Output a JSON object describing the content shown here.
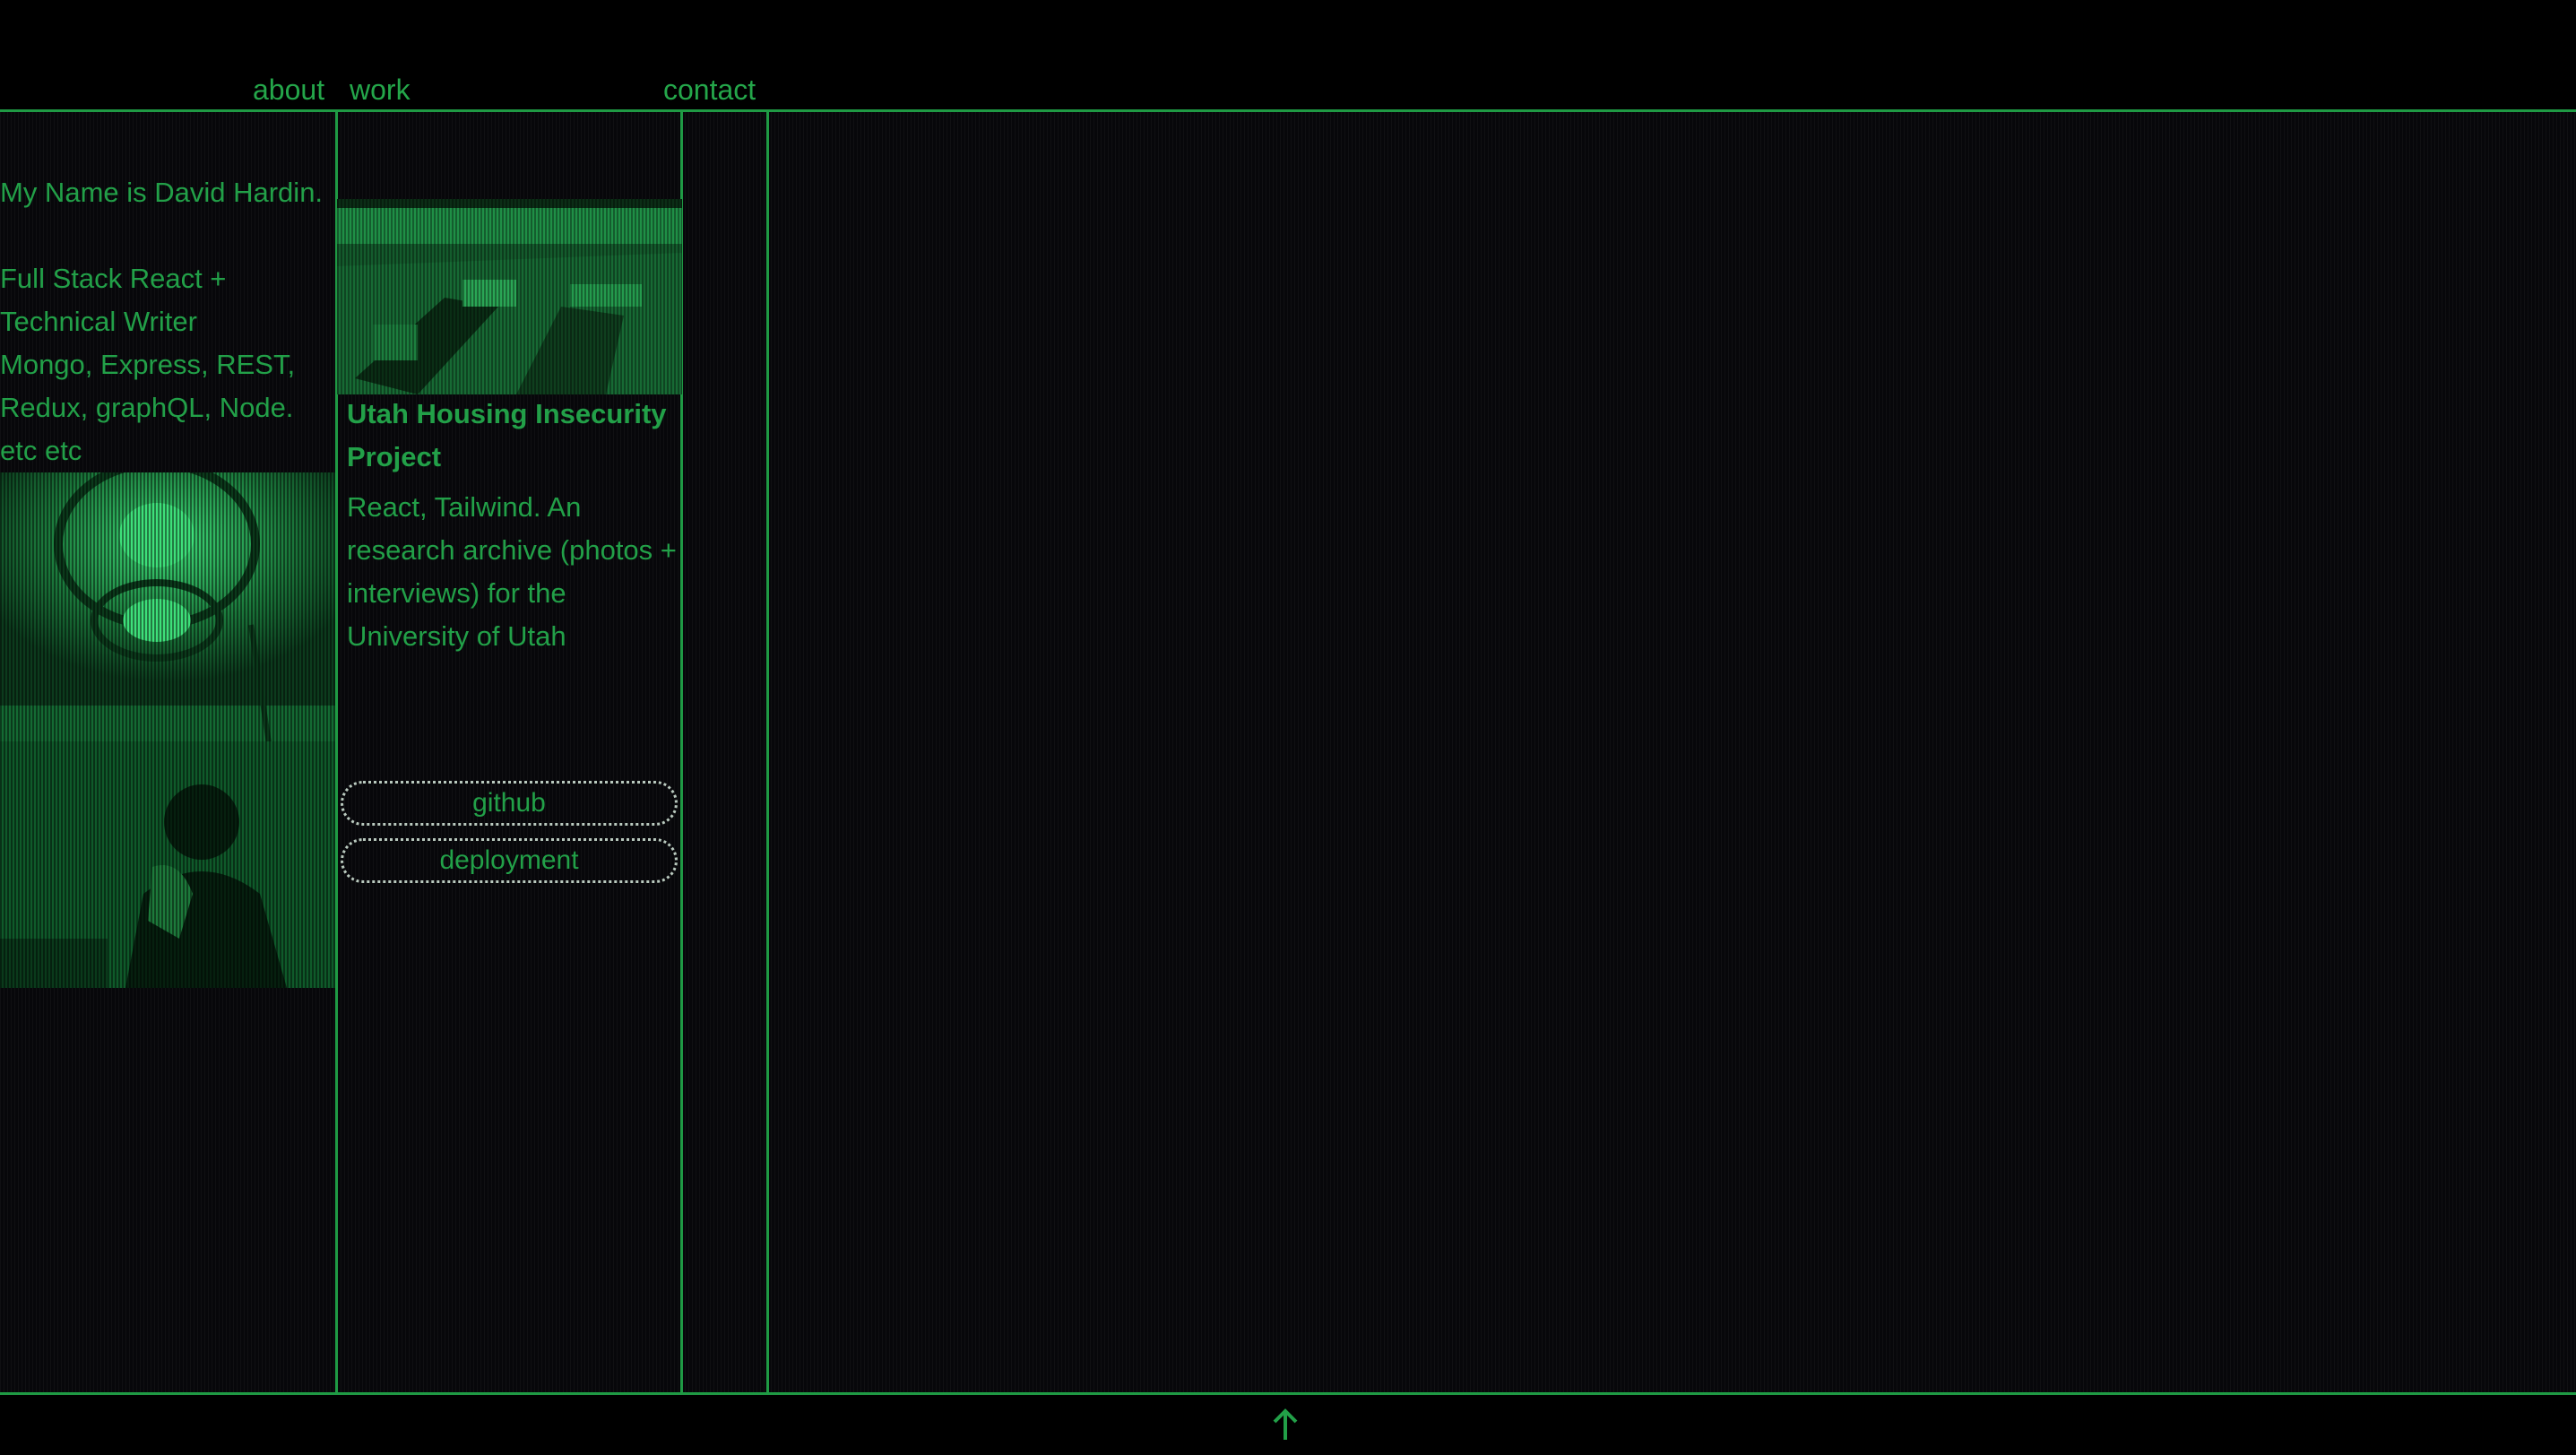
{
  "nav": {
    "about": "about",
    "work": "work",
    "contact": "contact"
  },
  "about": {
    "intro": "My Name is David Hardin.",
    "line1": "Full Stack React +",
    "line2": "Technical Writer",
    "line3": "Mongo, Express, REST,",
    "line4": "Redux, graphQL, Node.",
    "line5": "etc etc"
  },
  "project": {
    "title": "Utah Housing Insecurity Project",
    "description": "React, Tailwind. An research archive (photos + interviews) for the University of Utah",
    "github_label": "github",
    "deployment_label": "deployment"
  },
  "icons": {
    "back_to_top": "arrow-up-icon"
  },
  "colors": {
    "accent": "#22a048",
    "line": "#1f9a44",
    "background": "#000000",
    "pill_border": "#b9c9be"
  }
}
